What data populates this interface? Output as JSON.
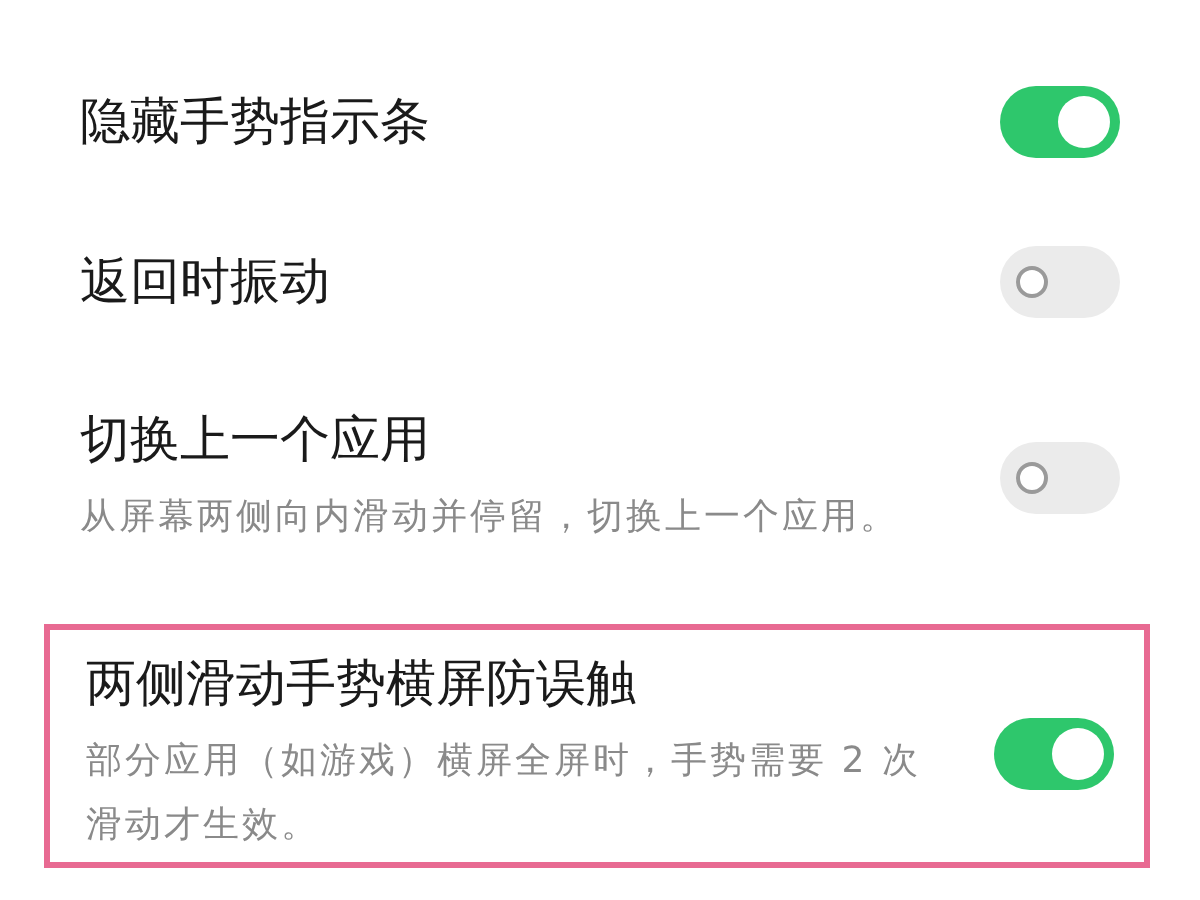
{
  "settings": [
    {
      "title": "隐藏手势指示条",
      "on": true,
      "highlighted": false
    },
    {
      "title": "返回时振动",
      "on": false,
      "highlighted": false
    },
    {
      "title": "切换上一个应用",
      "description": "从屏幕两侧向内滑动并停留，切换上一个应用。",
      "on": false,
      "highlighted": false
    },
    {
      "title": "两侧滑动手势横屏防误触",
      "description": "部分应用（如游戏）横屏全屏时，手势需要 2 次滑动才生效。",
      "on": true,
      "highlighted": true
    }
  ]
}
